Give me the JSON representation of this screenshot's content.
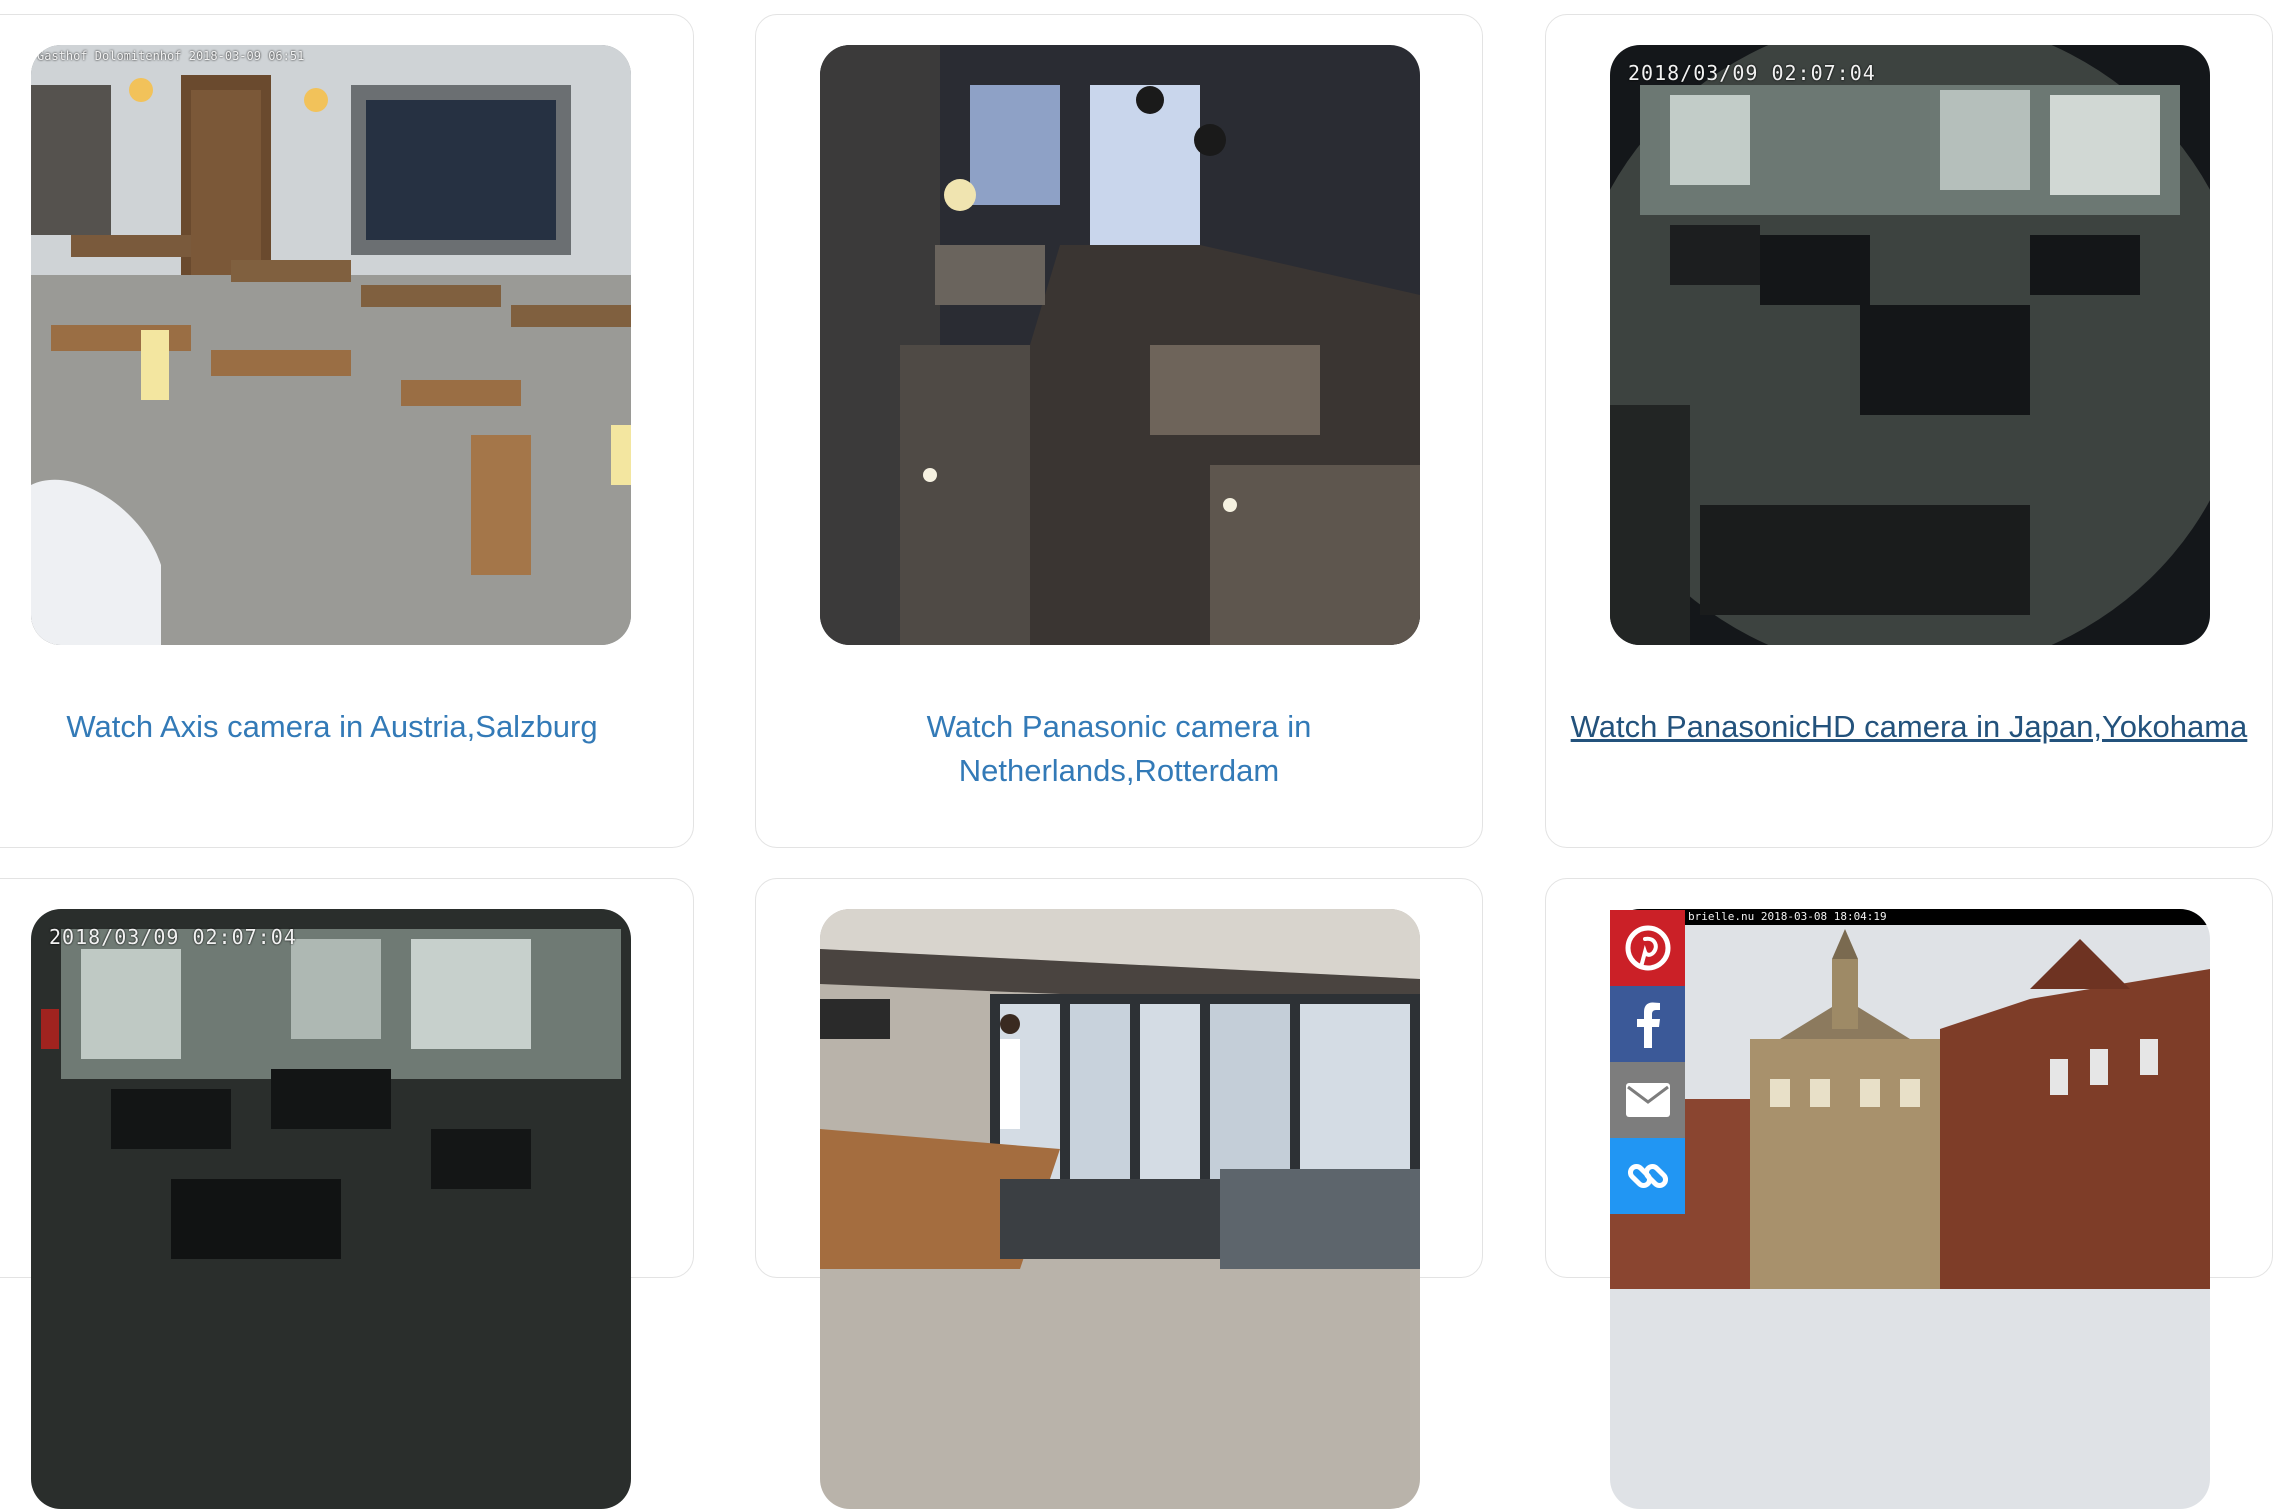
{
  "cards": [
    {
      "caption": "Watch Axis camera in Austria,Salzburg",
      "timestamp": "Gasthof Dolomitenhof 2018-03-09 06:51"
    },
    {
      "caption": "Watch Panasonic camera in Netherlands,Rotterdam",
      "timestamp": ""
    },
    {
      "caption": "Watch PanasonicHD camera in Japan,Yokohama",
      "timestamp": "2018/03/09  02:07:04"
    },
    {
      "caption": "",
      "timestamp": "2018/03/09  02:07:04"
    },
    {
      "caption": "",
      "timestamp": ""
    },
    {
      "caption": "",
      "timestamp": "brielle.nu 2018-03-08 18:04:19"
    }
  ],
  "share": [
    {
      "icon": "pinterest-icon",
      "color": "#cb2027"
    },
    {
      "icon": "facebook-icon",
      "color": "#3b5998"
    },
    {
      "icon": "email-icon",
      "color": "#7d7d7d"
    },
    {
      "icon": "link-icon",
      "color": "#2196f3"
    }
  ],
  "colors": {
    "link": "#337ab7",
    "link_active": "#23527c",
    "card_border": "#e3e3e3"
  }
}
